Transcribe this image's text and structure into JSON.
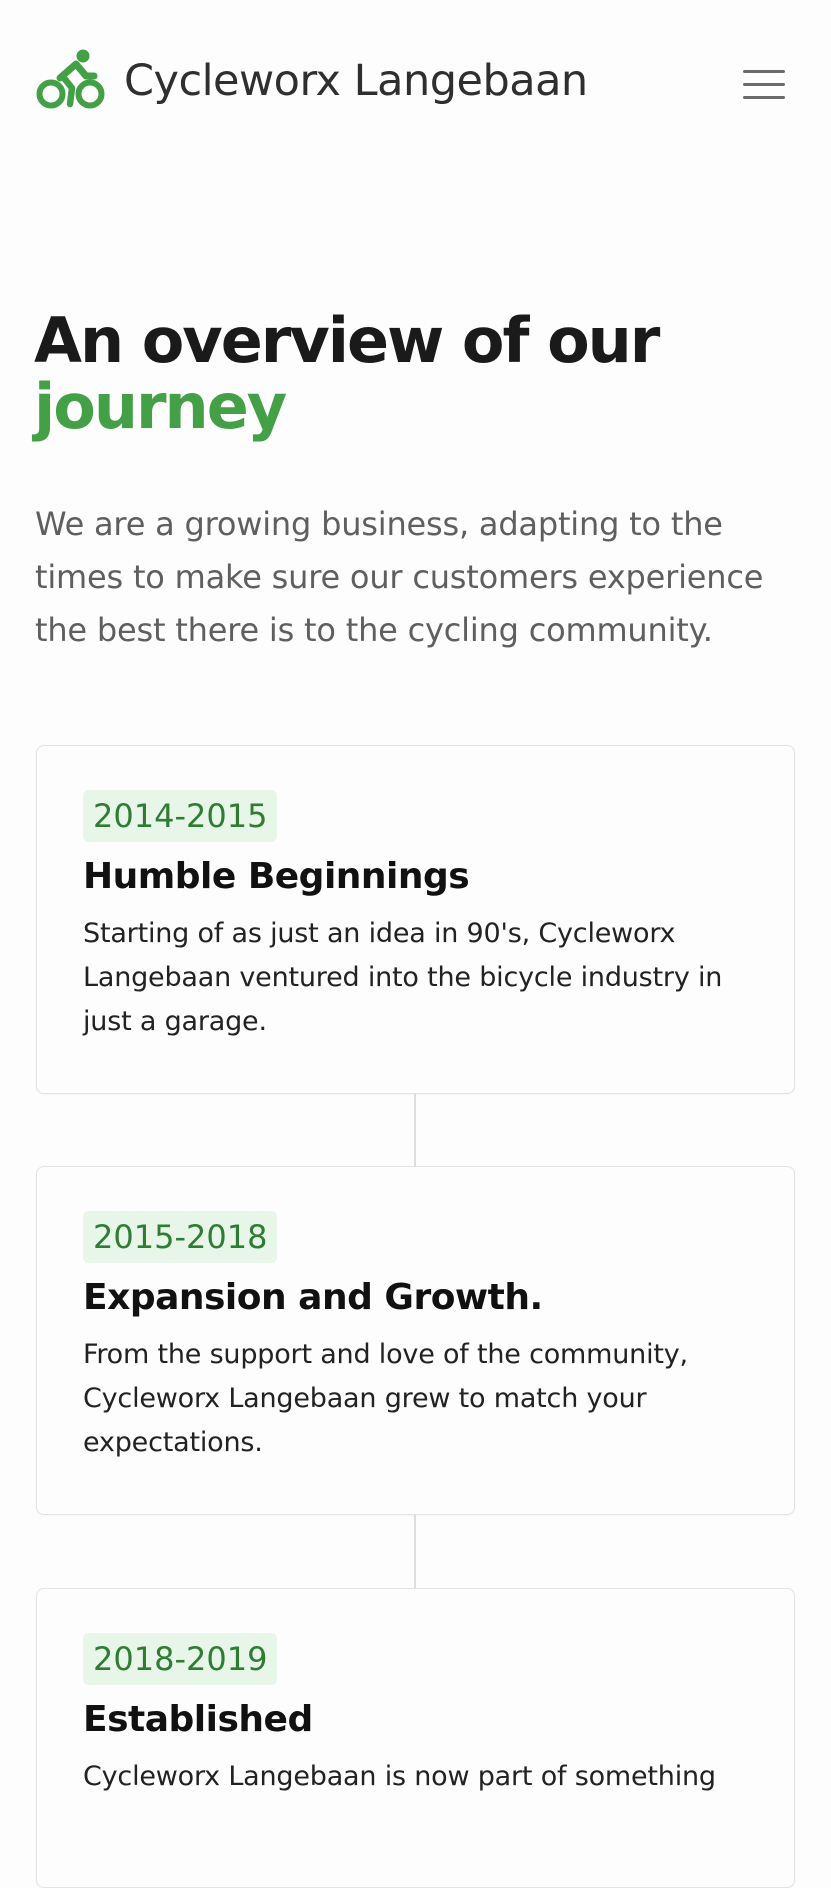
{
  "header": {
    "brand": "Cycleworx Langebaan",
    "logo_icon": "cyclist-icon",
    "menu_icon": "hamburger-menu-icon",
    "accent_color": "#43a047"
  },
  "hero": {
    "title_line1": "An overview of our",
    "title_accent": "journey",
    "description": "We are a growing business, adapting to the times to make sure our customers experience the best there is to the cycling community."
  },
  "timeline": [
    {
      "year": "2014-2015",
      "title": "Humble Beginnings",
      "description": "Starting of as just an idea in 90's, Cycleworx Langebaan ventured into the bicycle industry in just a garage."
    },
    {
      "year": "2015-2018",
      "title": "Expansion and Growth.",
      "description": "From the support and love of the community, Cycleworx Langebaan grew to match your expectations."
    },
    {
      "year": "2018-2019",
      "title": "Established",
      "description": "Cycleworx Langebaan is now part of something"
    }
  ]
}
